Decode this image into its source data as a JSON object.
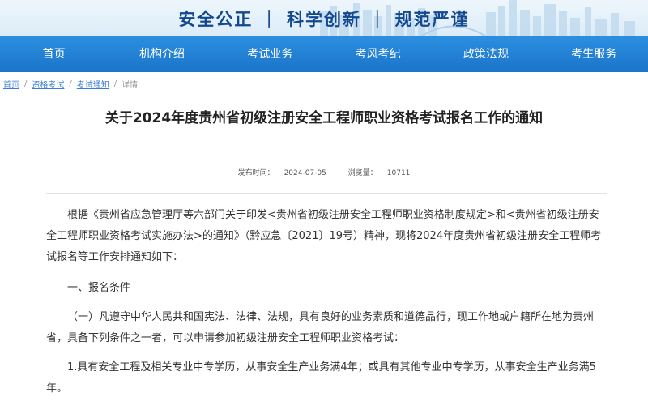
{
  "banner": {
    "slogan": "安全公正 ｜ 科学创新 ｜ 规范严谨"
  },
  "nav": {
    "items": [
      "首页",
      "机构介绍",
      "考试业务",
      "考风考纪",
      "政策法规",
      "考生服务"
    ]
  },
  "breadcrumb": {
    "home": "首页",
    "level1": "资格考试",
    "level2": "考试通知",
    "current": "详情",
    "separator": "/"
  },
  "article": {
    "title": "关于2024年度贵州省初级注册安全工程师职业资格考试报名工作的通知",
    "publish_label": "发布时间：",
    "publish_date": "2024-07-05",
    "views_label": "浏览量：",
    "views": "10711",
    "paragraphs": {
      "intro": "根据《贵州省应急管理厅等六部门关于印发<贵州省初级注册安全工程师职业资格制度规定>和<贵州省初级注册安全工程师职业资格考试实施办法>的通知》（黔应急〔2021〕19号）精神，现将2024年度贵州省初级注册安全工程师考试报名等工作安排通知如下：",
      "heading1": "一、报名条件",
      "cond1": "（一）凡遵守中华人民共和国宪法、法律、法规，具有良好的业务素质和道德品行，现工作地或户籍所在地为贵州省，具备下列条件之一者，可以申请参加初级注册安全工程师职业资格考试：",
      "item1": "1.具有安全工程及相关专业中专学历，从事安全生产业务满4年；或具有其他专业中专学历，从事安全生产业务满5年。"
    }
  }
}
